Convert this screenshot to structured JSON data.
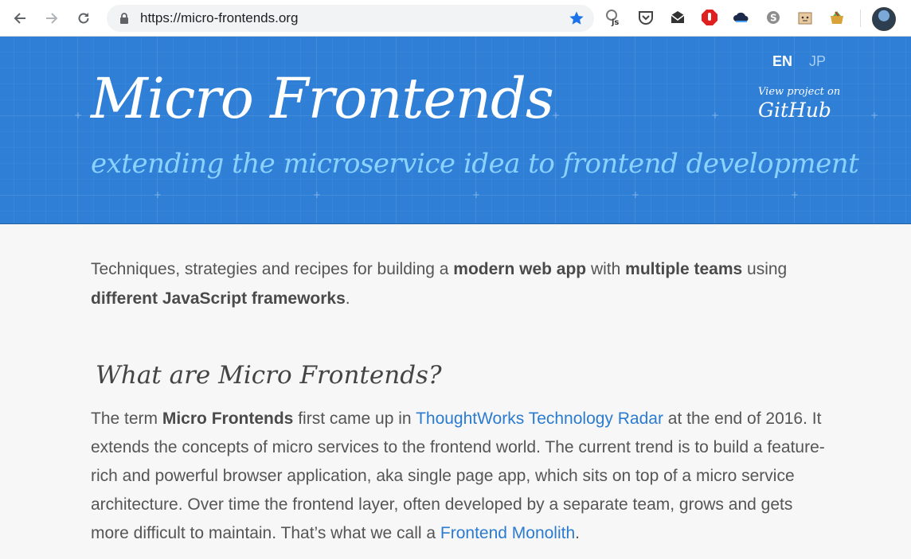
{
  "browser": {
    "url": "https://micro-frontends.org",
    "extensions": [
      "tampermonkey-js-icon",
      "pocket-icon",
      "mail-check-icon",
      "adblock-icon",
      "cloud-icon",
      "skype-icon",
      "box-face-icon",
      "bucket-icon"
    ]
  },
  "header": {
    "title": "Micro Frontends",
    "tagline": "extending the microservice idea to frontend development",
    "lang_en": "EN",
    "lang_jp": "JP",
    "github_small": "View project on",
    "github_big": "GitHub"
  },
  "intro": {
    "t1": "Techniques, strategies and recipes for building a ",
    "b1": "modern web app",
    "t2": " with ",
    "b2": "multiple teams",
    "t3": " using ",
    "b3": "different JavaScript frameworks",
    "t4": "."
  },
  "section": {
    "heading": "What are Micro Frontends?",
    "p1": "The term ",
    "b1": "Micro Frontends",
    "p2": " first came up in ",
    "link1": "ThoughtWorks Technology Radar",
    "p3": " at the end of 2016. It extends the concepts of micro services to the frontend world. The current trend is to build a feature-rich and powerful browser application, aka single page app, which sits on top of a micro service architecture. Over time the frontend layer, often developed by a separate team, grows and gets more difficult to maintain. That’s what we call a ",
    "link2": "Frontend Monolith",
    "p4": "."
  },
  "colors": {
    "header_bg": "#2f7fd6",
    "tagline": "#8ad2ff",
    "link": "#2b7bd0",
    "text": "#555555"
  }
}
